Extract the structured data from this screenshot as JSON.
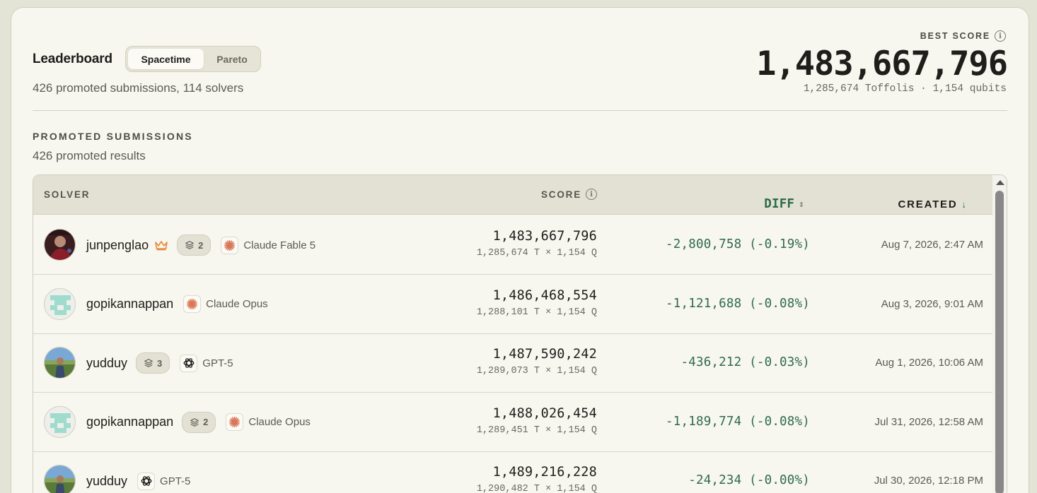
{
  "header": {
    "title": "Leaderboard",
    "tabs": [
      {
        "label": "Spacetime",
        "active": true
      },
      {
        "label": "Pareto",
        "active": false
      }
    ],
    "subtitle": "426 promoted submissions, 114 solvers"
  },
  "best": {
    "label": "BEST SCORE",
    "score": "1,483,667,796",
    "sub": "1,285,674 Toffolis · 1,154 qubits"
  },
  "section": {
    "title": "PROMOTED SUBMISSIONS",
    "subtitle": "426 promoted results"
  },
  "table": {
    "columns": {
      "solver": "SOLVER",
      "score": "SCORE",
      "diff": "DIFF",
      "created": "CREATED"
    },
    "rows": [
      {
        "name": "junpenglao",
        "crown": true,
        "layers": "2",
        "model": "Claude Fable 5",
        "model_icon": "claude-icon",
        "score": "1,483,667,796",
        "score_sub": "1,285,674 T × 1,154 Q",
        "diff": "-2,800,758 (-0.19%)",
        "created": "Aug 7, 2026, 2:47 AM",
        "avatar": "photo"
      },
      {
        "name": "gopikannappan",
        "crown": false,
        "layers": "",
        "model": "Claude Opus",
        "model_icon": "claude-icon",
        "score": "1,486,468,554",
        "score_sub": "1,288,101 T × 1,154 Q",
        "diff": "-1,121,688 (-0.08%)",
        "created": "Aug 3, 2026, 9:01 AM",
        "avatar": "identicon"
      },
      {
        "name": "yudduy",
        "crown": false,
        "layers": "3",
        "model": "GPT-5",
        "model_icon": "openai-icon",
        "score": "1,487,590,242",
        "score_sub": "1,289,073 T × 1,154 Q",
        "diff": "-436,212 (-0.03%)",
        "created": "Aug 1, 2026, 10:06 AM",
        "avatar": "outdoor"
      },
      {
        "name": "gopikannappan",
        "crown": false,
        "layers": "2",
        "model": "Claude Opus",
        "model_icon": "claude-icon",
        "score": "1,488,026,454",
        "score_sub": "1,289,451 T × 1,154 Q",
        "diff": "-1,189,774 (-0.08%)",
        "created": "Jul 31, 2026, 12:58 AM",
        "avatar": "identicon"
      },
      {
        "name": "yudduy",
        "crown": false,
        "layers": "",
        "model": "GPT-5",
        "model_icon": "openai-icon",
        "score": "1,489,216,228",
        "score_sub": "1,290,482 T × 1,154 Q",
        "diff": "-24,234 (-0.00%)",
        "created": "Jul 30, 2026, 12:18 PM",
        "avatar": "outdoor"
      }
    ]
  },
  "colors": {
    "background": "#e3e3d6",
    "card": "#f7f6ef",
    "diff_green": "#2f6b4c",
    "crown_orange": "#e8893a",
    "claude_orange": "#d97757"
  }
}
